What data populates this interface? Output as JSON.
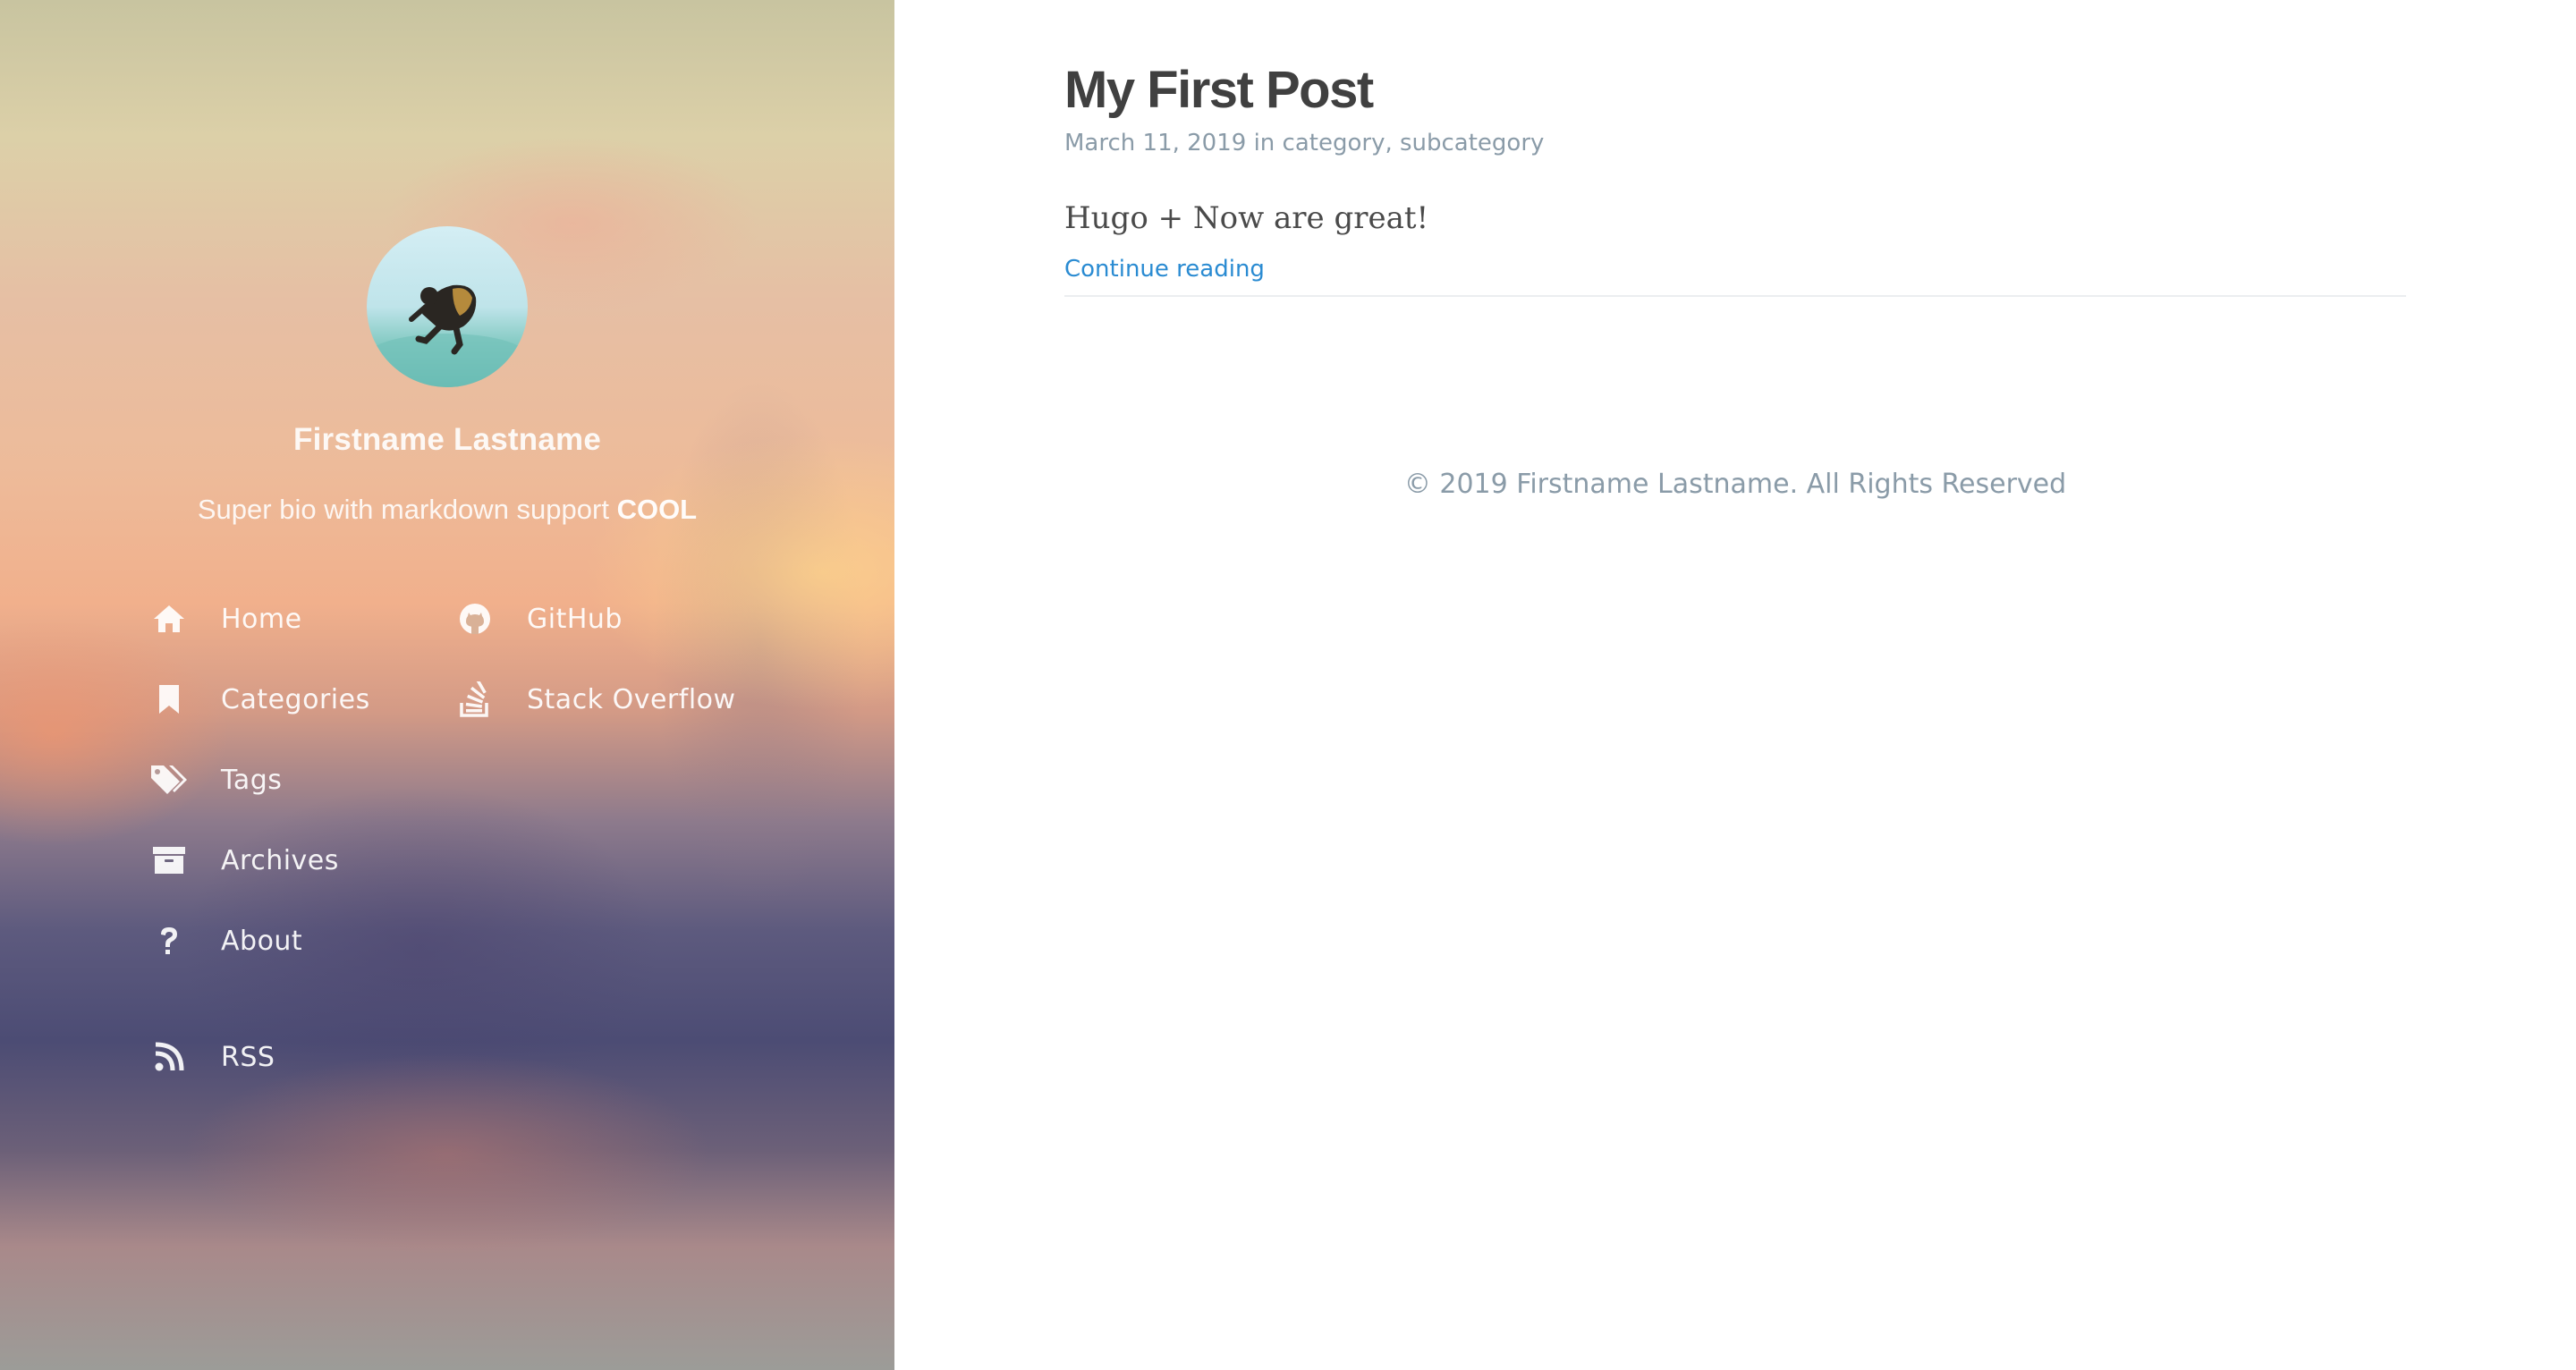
{
  "sidebar": {
    "author_name": "Firstname Lastname",
    "bio_text": "Super bio with markdown support ",
    "bio_bold": "COOL",
    "avatar_alt": "person-jumping-icon",
    "nav_left": [
      {
        "label": "Home",
        "icon": "home-icon"
      },
      {
        "label": "Categories",
        "icon": "bookmark-icon"
      },
      {
        "label": "Tags",
        "icon": "tags-icon"
      },
      {
        "label": "Archives",
        "icon": "archive-icon"
      },
      {
        "label": "About",
        "icon": "question-icon"
      }
    ],
    "nav_right": [
      {
        "label": "GitHub",
        "icon": "github-icon"
      },
      {
        "label": "Stack Overflow",
        "icon": "stack-overflow-icon"
      }
    ],
    "rss": {
      "label": "RSS",
      "icon": "rss-icon"
    }
  },
  "post": {
    "title": "My First Post",
    "date": "March 11, 2019",
    "in_text": " in ",
    "category_1": "category",
    "separator": ", ",
    "category_2": "subcategory",
    "excerpt": "Hugo + Now are great!",
    "continue_label": "Continue reading"
  },
  "footer": {
    "copyright": "© 2019 Firstname Lastname. All Rights Reserved"
  },
  "colors": {
    "link_blue": "#2a8bd2",
    "meta_gray": "#8a9ba8",
    "title_dark": "#404040"
  }
}
